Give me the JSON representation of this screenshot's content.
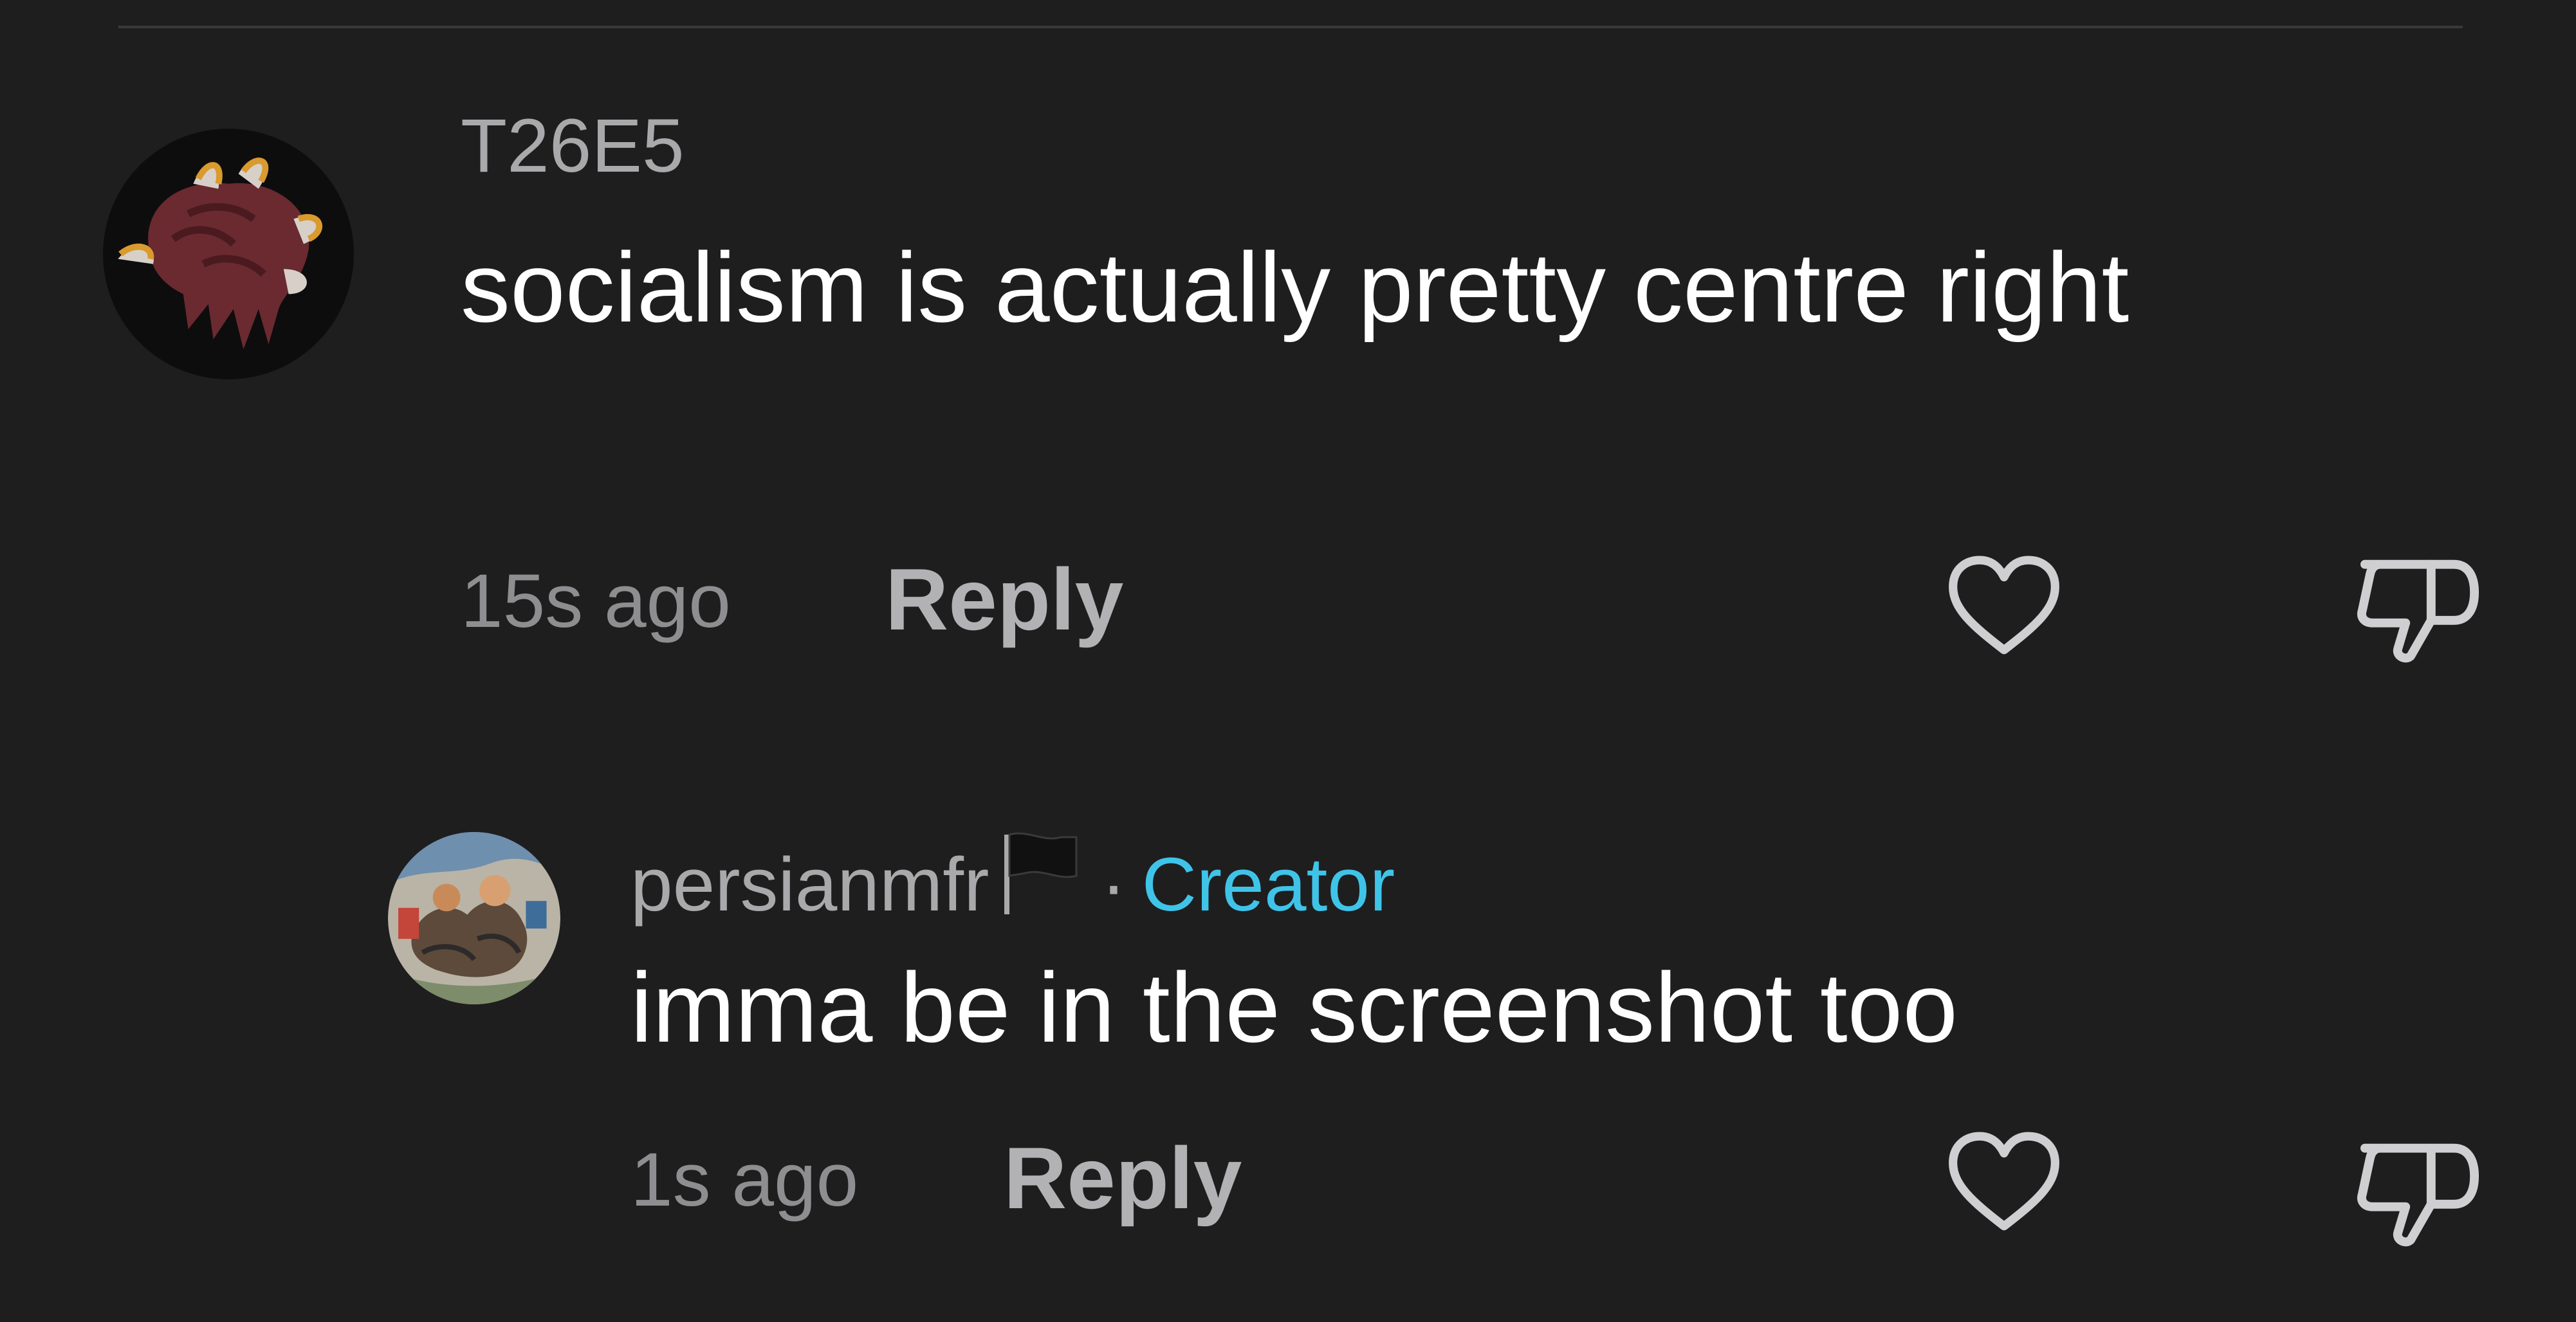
{
  "comments": [
    {
      "username": "T26E5",
      "text": "socialism is actually pretty centre right",
      "time": "15s ago",
      "reply_label": "Reply"
    }
  ],
  "replies": [
    {
      "username": "persianmfr",
      "separator": "·",
      "badge": "Creator",
      "text": "imma be in the screenshot too",
      "time": "1s ago",
      "reply_label": "Reply"
    }
  ],
  "icons": {
    "like": "heart-outline-icon",
    "dislike": "thumbs-down-icon",
    "flag": "black-flag-icon"
  },
  "colors": {
    "background": "#1e1e1f",
    "username": "#a9a9ab",
    "text": "#ffffff",
    "meta": "#8e8e90",
    "creator_badge": "#3fc4e8"
  }
}
